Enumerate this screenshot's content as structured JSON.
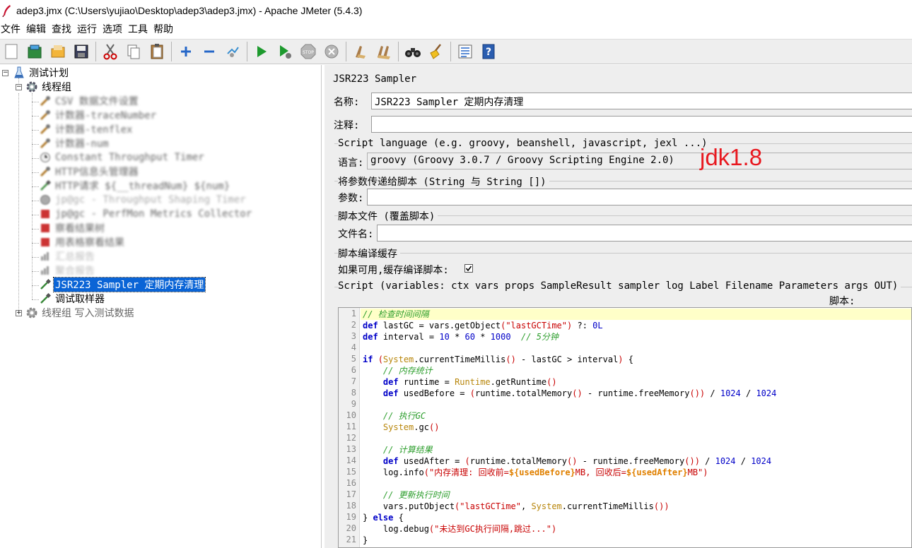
{
  "window": {
    "title": "adep3.jmx (C:\\Users\\yujiao\\Desktop\\adep3\\adep3.jmx) - Apache JMeter (5.4.3)"
  },
  "menu": [
    "文件",
    "编辑",
    "查找",
    "运行",
    "选项",
    "工具",
    "帮助"
  ],
  "toolbar": [
    {
      "icon": "new-icon"
    },
    {
      "icon": "templates-icon"
    },
    {
      "icon": "open-icon"
    },
    {
      "icon": "save-icon"
    },
    {
      "icon": "cut-icon"
    },
    {
      "icon": "copy-icon"
    },
    {
      "icon": "paste-icon"
    },
    {
      "icon": "expand-icon"
    },
    {
      "icon": "collapse-icon"
    },
    {
      "icon": "toggle-icon"
    },
    {
      "icon": "start-icon"
    },
    {
      "icon": "start-no-pause-icon"
    },
    {
      "icon": "stop-icon"
    },
    {
      "icon": "shutdown-icon"
    },
    {
      "icon": "clear-icon"
    },
    {
      "icon": "clear-all-icon"
    },
    {
      "icon": "search-icon"
    },
    {
      "icon": "reset-search-icon"
    },
    {
      "icon": "function-helper-icon"
    },
    {
      "icon": "help-icon"
    }
  ],
  "tree": {
    "items": [
      {
        "label": "测试计划"
      },
      {
        "label": "线程组"
      },
      {
        "label": "CSV 数据文件设置"
      },
      {
        "label": "计数器-traceNumber"
      },
      {
        "label": "计数器-tenflex"
      },
      {
        "label": "计数器-num"
      },
      {
        "label": "Constant Throughput Timer"
      },
      {
        "label": "HTTP信息头管理器"
      },
      {
        "label": "HTTP请求  ${__threadNum}  ${num}"
      },
      {
        "label": "jp@gc - Throughput Shaping Timer"
      },
      {
        "label": "jp@gc - PerfMon Metrics Collector"
      },
      {
        "label": "察看结果树"
      },
      {
        "label": "用表格察看结果"
      },
      {
        "label": "汇总报告"
      },
      {
        "label": "聚合报告"
      },
      {
        "label": "JSR223 Sampler 定期内存清理"
      },
      {
        "label": "调试取样器"
      },
      {
        "label": "线程组  写入测试数据"
      }
    ]
  },
  "panel": {
    "title": "JSR223 Sampler",
    "name_label": "名称:",
    "name_value": "JSR223 Sampler 定期内存清理",
    "comment_label": "注释:",
    "comment_value": "",
    "lang_group": "Script language (e.g. groovy, beanshell, javascript, jexl ...)",
    "lang_label": "语言:",
    "lang_value": "groovy     (Groovy 3.0.7 / Groovy Scripting Engine 2.0)",
    "jdk_note": "jdk1.8",
    "params_group": "将参数传递给脚本 (String 与 String [])",
    "params_label": "参数:",
    "params_value": "",
    "file_group": "脚本文件 (覆盖脚本)",
    "file_label": "文件名:",
    "file_value": "",
    "cache_group": "脚本编译缓存",
    "cache_label": "如果可用,缓存编译脚本:",
    "cache_checked": true,
    "script_group": "Script (variables: ctx vars props SampleResult sampler log Label Filename Parameters args OUT)",
    "script_label": "脚本:"
  },
  "code": {
    "line_numbers": [
      "1",
      "2",
      "3",
      "4",
      "5",
      "6",
      "7",
      "8",
      "9",
      "10",
      "11",
      "12",
      "13",
      "14",
      "15",
      "16",
      "17",
      "18",
      "19",
      "20",
      "21"
    ],
    "lines": [
      "// 检查时间间隔",
      "def lastGC = vars.getObject(\"lastGCTime\") ?: 0L",
      "def interval = 10 * 60 * 1000  // 5分钟",
      "",
      "if (System.currentTimeMillis() - lastGC > interval) {",
      "    // 内存统计",
      "    def runtime = Runtime.getRuntime()",
      "    def usedBefore = (runtime.totalMemory() - runtime.freeMemory()) / 1024 / 1024",
      "",
      "    // 执行GC",
      "    System.gc()",
      "",
      "    // 计算结果",
      "    def usedAfter = (runtime.totalMemory() - runtime.freeMemory()) / 1024 / 1024",
      "    log.info(\"内存清理: 回收前=${usedBefore}MB, 回收后=${usedAfter}MB\")",
      "",
      "    // 更新执行时间",
      "    vars.putObject(\"lastGCTime\", System.currentTimeMillis())",
      "} else {",
      "    log.debug(\"未达到GC执行间隔,跳过...\")",
      "}"
    ]
  },
  "colors": {
    "selection": "#0a64d6",
    "note_red": "#e8181f",
    "keyword": "#0000c8",
    "comment": "#2d9e2d",
    "string": "#c80000"
  }
}
